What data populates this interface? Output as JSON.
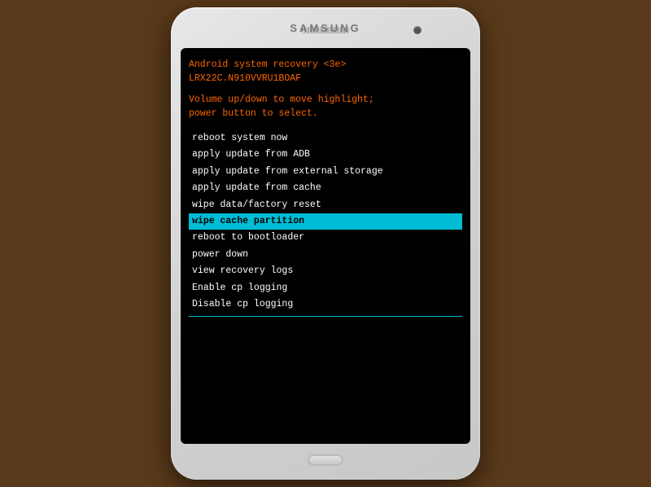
{
  "phone": {
    "brand": "SAMSUNG",
    "recovery": {
      "title_line1": "Android system recovery <3e>",
      "title_line2": "LRX22C.N910VVRU1BOAF",
      "instructions_line1": "Volume up/down to move highlight;",
      "instructions_line2": "power button to select.",
      "menu_items": [
        {
          "id": "reboot-system",
          "label": "reboot system now",
          "selected": false
        },
        {
          "id": "apply-update-adb",
          "label": "apply update from ADB",
          "selected": false
        },
        {
          "id": "apply-update-external",
          "label": "apply update from external storage",
          "selected": false
        },
        {
          "id": "apply-update-cache",
          "label": "apply update from cache",
          "selected": false
        },
        {
          "id": "wipe-data",
          "label": "wipe data/factory reset",
          "selected": false
        },
        {
          "id": "wipe-cache",
          "label": "wipe cache partition",
          "selected": true
        },
        {
          "id": "reboot-bootloader",
          "label": "reboot to bootloader",
          "selected": false
        },
        {
          "id": "power-down",
          "label": "power down",
          "selected": false
        },
        {
          "id": "view-recovery-logs",
          "label": "view recovery logs",
          "selected": false
        },
        {
          "id": "enable-cp-logging",
          "label": "Enable cp logging",
          "selected": false
        },
        {
          "id": "disable-cp-logging",
          "label": "Disable cp logging",
          "selected": false
        }
      ]
    }
  }
}
